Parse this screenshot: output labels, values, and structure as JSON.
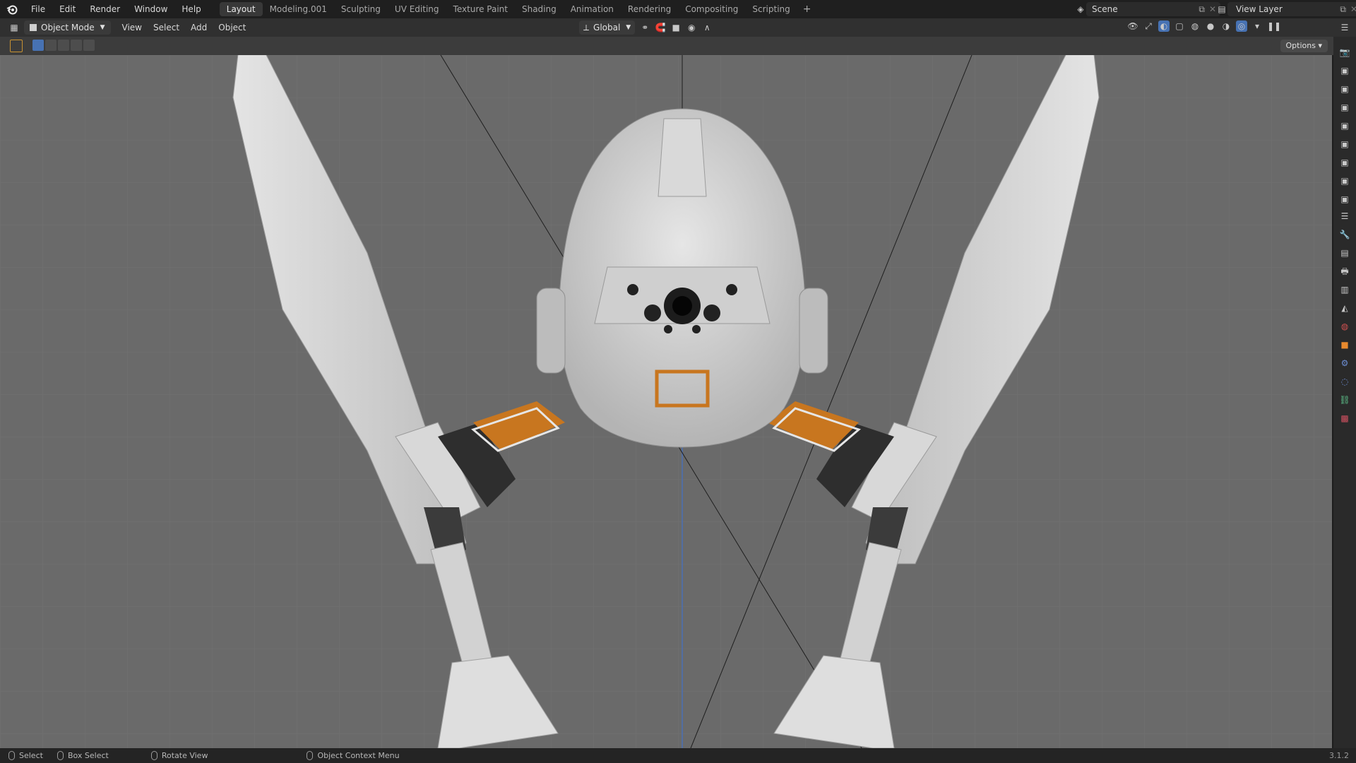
{
  "app": {
    "logo_icon": "blender-logo-icon"
  },
  "menu": [
    "File",
    "Edit",
    "Render",
    "Window",
    "Help"
  ],
  "workspace_tabs": [
    {
      "label": "Layout",
      "active": true
    },
    {
      "label": "Modeling.001",
      "active": false
    },
    {
      "label": "Sculpting",
      "active": false
    },
    {
      "label": "UV Editing",
      "active": false
    },
    {
      "label": "Texture Paint",
      "active": false
    },
    {
      "label": "Shading",
      "active": false
    },
    {
      "label": "Animation",
      "active": false
    },
    {
      "label": "Rendering",
      "active": false
    },
    {
      "label": "Compositing",
      "active": false
    },
    {
      "label": "Scripting",
      "active": false
    }
  ],
  "workspace_add": "+",
  "scene": {
    "label": "Scene"
  },
  "view_layer": {
    "label": "View Layer"
  },
  "header": {
    "mode": "Object Mode",
    "view": "View",
    "select": "Select",
    "add": "Add",
    "object": "Object",
    "orientation": "Global"
  },
  "toolbar": {
    "options": "Options"
  },
  "status": {
    "select": "Select",
    "box_select": "Box Select",
    "rotate_view": "Rotate View",
    "context_menu": "Object Context Menu",
    "version": "3.1.2"
  },
  "colors": {
    "accent": "#4772b3",
    "viewport_bg": "#6a6a6a",
    "orange": "#c8761f"
  }
}
